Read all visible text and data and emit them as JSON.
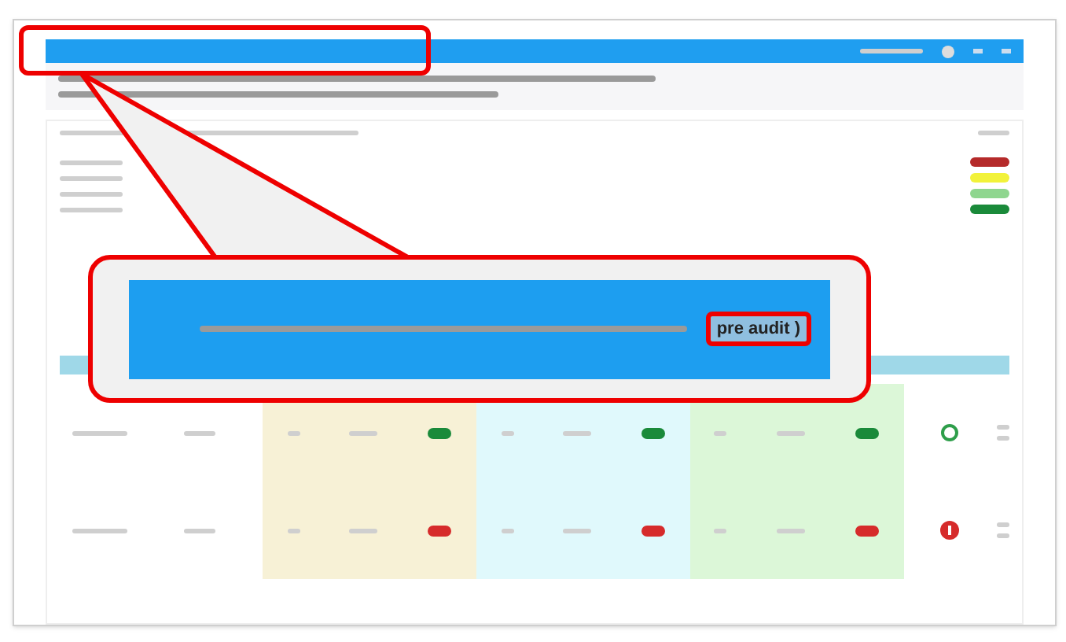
{
  "legend": [
    {
      "color": "#b52a2a"
    },
    {
      "color": "#f2f23a"
    },
    {
      "color": "#8fd68f"
    },
    {
      "color": "#1a8a3a"
    }
  ],
  "rows": [
    {
      "pills": [
        {
          "color": "#1a8a3a"
        },
        {
          "color": "#1a8a3a"
        },
        {
          "color": "#1a8a3a"
        }
      ],
      "kind": "pass"
    },
    {
      "pills": [
        {
          "color": "#d62b2b"
        },
        {
          "color": "#d62b2b"
        },
        {
          "color": "#d62b2b"
        }
      ],
      "kind": "fail"
    }
  ],
  "callout": {
    "label": "pre audit )"
  }
}
